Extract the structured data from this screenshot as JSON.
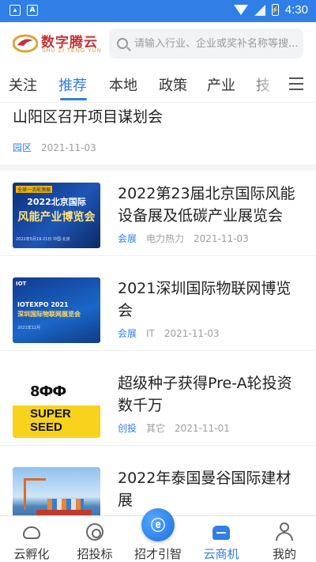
{
  "status_bar": {
    "time": "4:30",
    "icons": [
      "gallery-icon",
      "a-icon",
      "wifi-icon",
      "signal-icon",
      "battery-icon"
    ]
  },
  "header": {
    "logo_text": "数字腾云",
    "logo_subtext": "SHU ZI TENG YUN",
    "search_placeholder": "请输入行业、企业或奖补名称等搜..."
  },
  "tabs": [
    {
      "label": "关注",
      "active": false
    },
    {
      "label": "推荐",
      "active": true
    },
    {
      "label": "本地",
      "active": false
    },
    {
      "label": "政策",
      "active": false
    },
    {
      "label": "产业",
      "active": false
    },
    {
      "label": "技",
      "active": false
    }
  ],
  "feed": {
    "partial_item": {
      "title": "山阳区召开项目谋划会",
      "category": "园区",
      "date": "2021-11-03"
    },
    "items": [
      {
        "title": "2022第23届北京国际风能设备展及低碳产业展览会",
        "category": "会展",
        "subcategory": "电力热力",
        "date": "2021-11-03",
        "thumb": {
          "tag": "全球一流能源展",
          "line1": "2022北京国际",
          "line2": "风能产业博览会",
          "line3": "2022年5月19-21日 中国·北京"
        }
      },
      {
        "title": "2021深圳国际物联网博览会",
        "category": "会展",
        "subcategory": "IT",
        "date": "2021-11-03",
        "thumb": {
          "tag": "IOT",
          "line1": "IOTEXPO 2021",
          "line2": "深圳国际物联网展览会",
          "line3": "2021年12月"
        }
      },
      {
        "title": "超级种子获得Pre-A轮投资数千万",
        "category": "创投",
        "subcategory": "其它",
        "date": "2021-11-01",
        "thumb": {
          "glyph": "8ФФ",
          "word1": "SUPER",
          "word2": "SEED"
        }
      },
      {
        "title": "2022年泰国曼谷国际建材展",
        "category": "",
        "subcategory": "",
        "date": "",
        "thumb": {}
      }
    ]
  },
  "bottom_nav": [
    {
      "label": "云孵化",
      "icon": "cloud-icon",
      "active": false
    },
    {
      "label": "招投标",
      "icon": "target-icon",
      "active": false
    },
    {
      "label": "招才引智",
      "icon": "center-logo-icon",
      "active": false
    },
    {
      "label": "云商机",
      "icon": "shop-icon",
      "active": true
    },
    {
      "label": "我的",
      "icon": "user-icon",
      "active": false
    }
  ],
  "colors": {
    "accent": "#2f7fe6",
    "logo_red": "#c4343a",
    "meta_gray": "#9e9e9e"
  }
}
